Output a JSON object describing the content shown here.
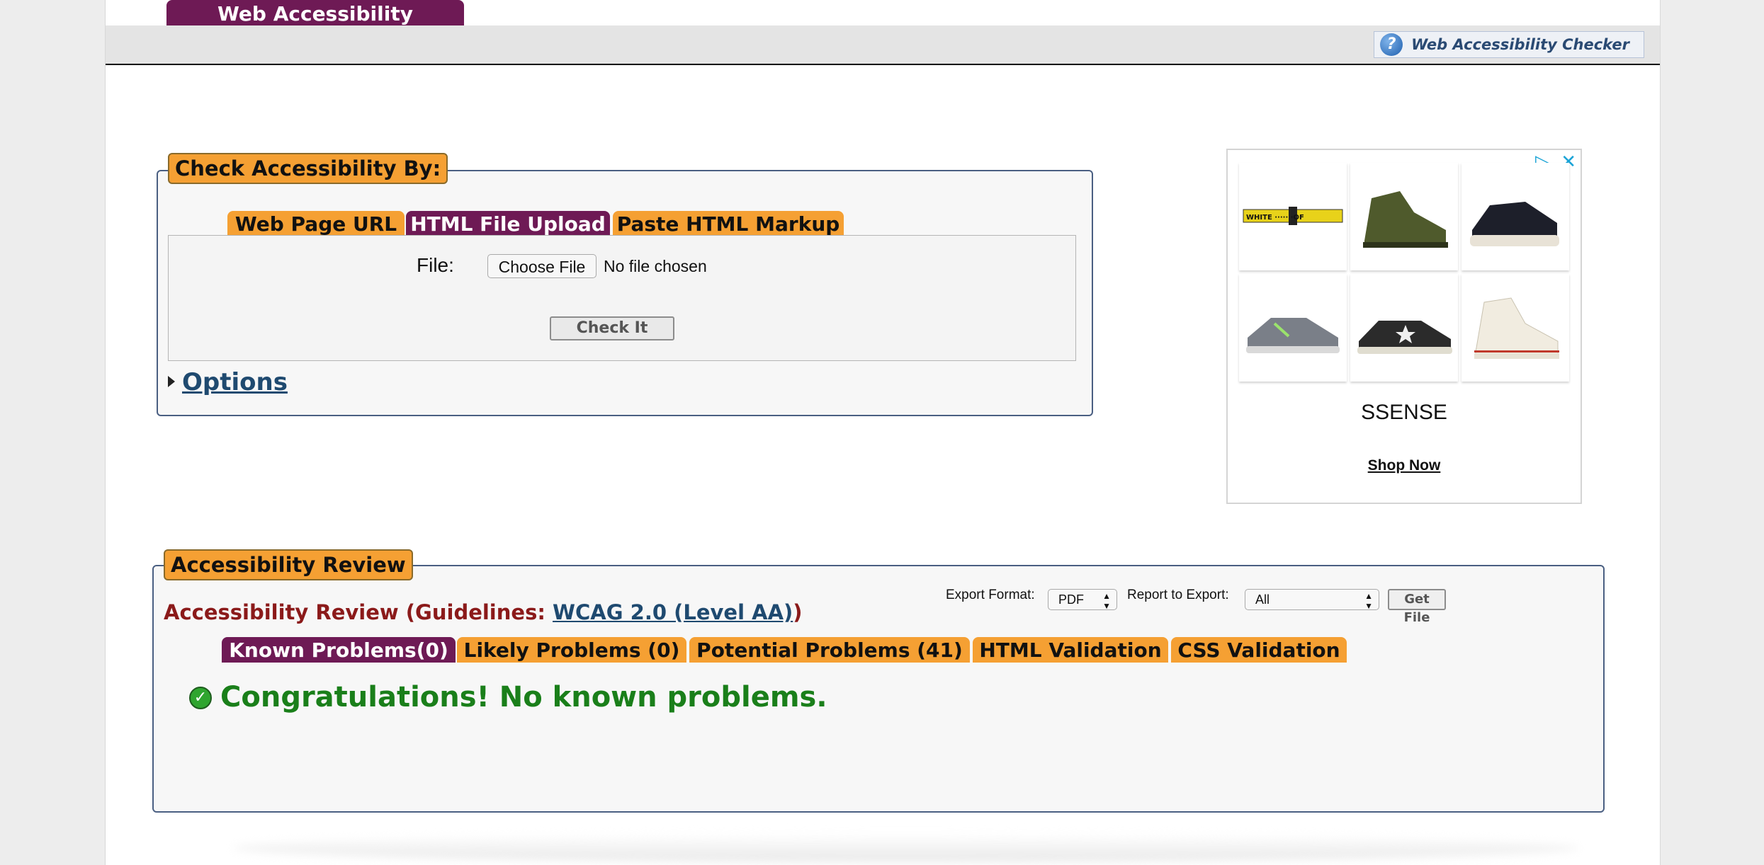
{
  "header": {
    "top_tab": "Web Accessibility Checker",
    "help_link": "Web Accessibility Checker",
    "help_icon": "?"
  },
  "check_panel": {
    "legend": "Check Accessibility By:",
    "tabs": [
      {
        "label": "Web Page URL",
        "active": false
      },
      {
        "label": "HTML File Upload",
        "active": true
      },
      {
        "label": "Paste HTML Markup",
        "active": false
      }
    ],
    "file_label": "File:",
    "choose_button": "Choose File",
    "no_file_text": "No file chosen",
    "check_button": "Check It",
    "options_link": "Options"
  },
  "ad": {
    "brand": "SSENSE",
    "cta": "Shop Now",
    "adchoices_icon": "▷",
    "close_icon": "✕",
    "belt_text": "WHITE ····· ·OF"
  },
  "review_panel": {
    "legend": "Accessibility Review",
    "title_prefix": "Accessibility Review (Guidelines: ",
    "guideline_link": "WCAG 2.0 (Level AA)",
    "title_suffix": ")",
    "export_format_label": "Export Format:",
    "export_format_value": "PDF",
    "report_label": "Report to Export:",
    "report_value": "All",
    "get_file_button": "Get File",
    "tabs": [
      {
        "label": "Known Problems(0)",
        "active": true
      },
      {
        "label": "Likely Problems (0)",
        "active": false
      },
      {
        "label": "Potential Problems (41)",
        "active": false
      },
      {
        "label": "HTML Validation",
        "active": false
      },
      {
        "label": "CSS Validation",
        "active": false
      }
    ],
    "congrats": "Congratulations! No known problems.",
    "check_icon": "✓"
  },
  "colors": {
    "purple": "#6e1a55",
    "orange": "#f5a033",
    "link": "#1f4a70",
    "dark_red": "#8b1a1a",
    "success": "#1a7f1a"
  }
}
